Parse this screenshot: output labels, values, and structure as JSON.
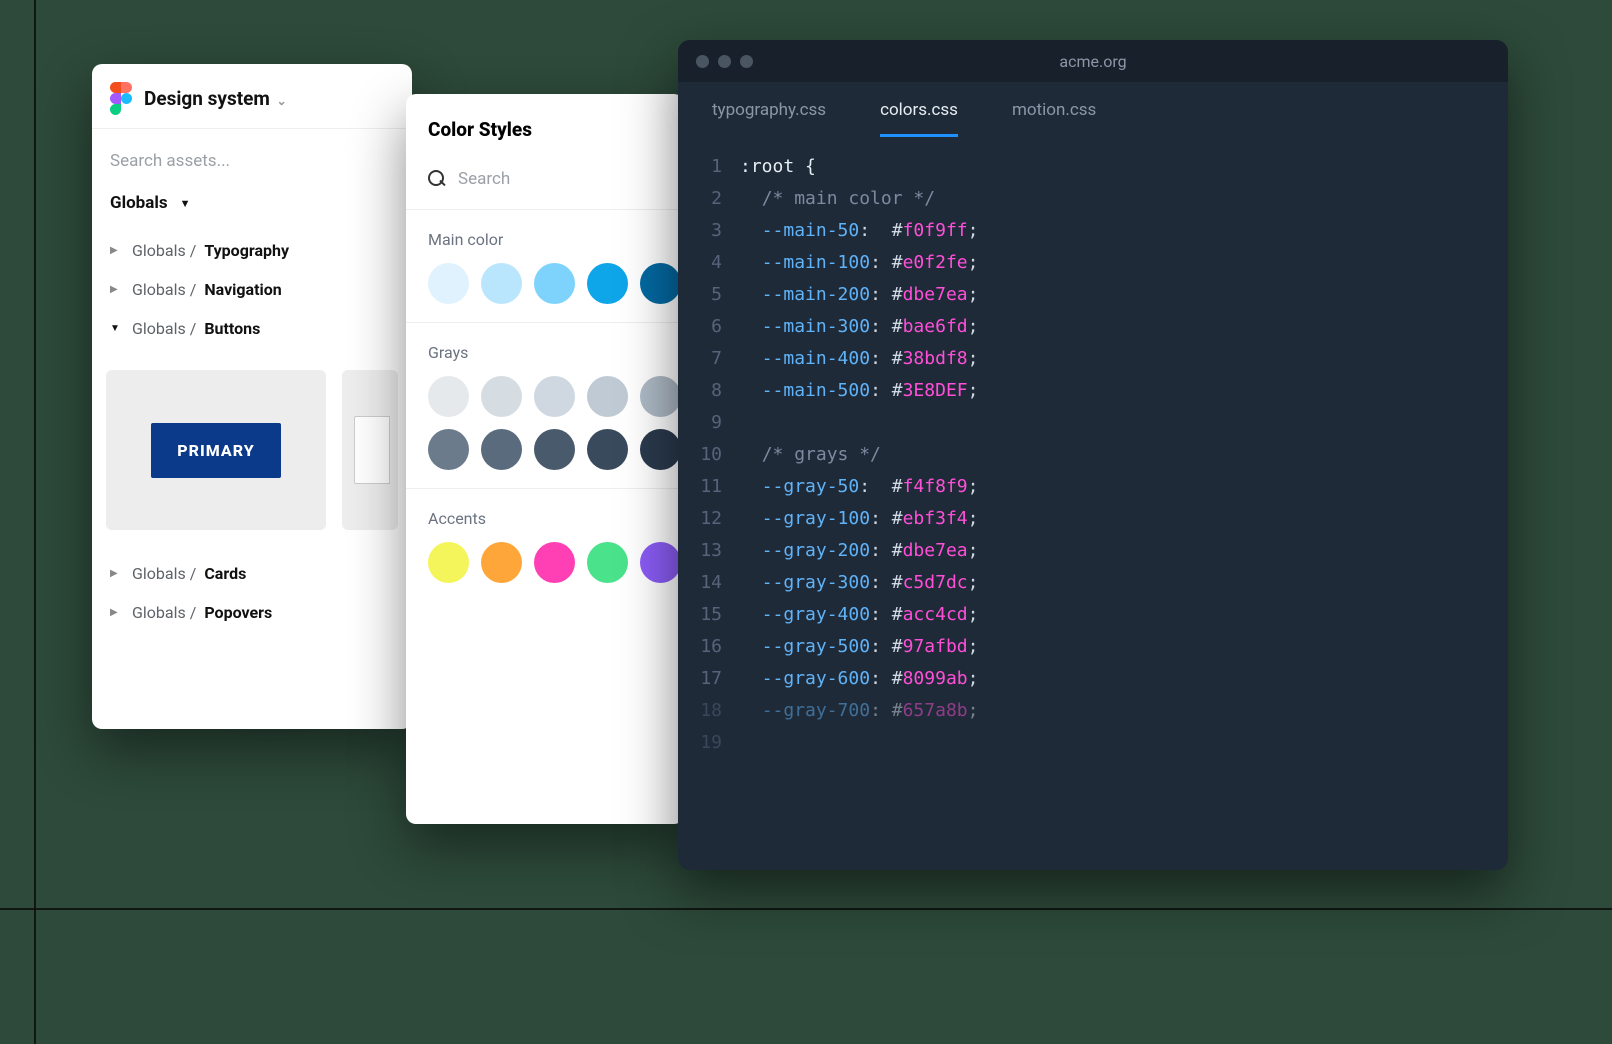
{
  "figma": {
    "title": "Design system",
    "search_placeholder": "Search assets...",
    "section": "Globals",
    "tree": [
      {
        "prefix": "Globals / ",
        "label": "Typography",
        "expanded": false
      },
      {
        "prefix": "Globals / ",
        "label": "Navigation",
        "expanded": false
      },
      {
        "prefix": "Globals / ",
        "label": "Buttons",
        "expanded": true
      },
      {
        "prefix": "Globals / ",
        "label": "Cards",
        "expanded": false
      },
      {
        "prefix": "Globals / ",
        "label": "Popovers",
        "expanded": false
      }
    ],
    "primary_button_label": "PRIMARY"
  },
  "styles": {
    "title": "Color Styles",
    "search_placeholder": "Search",
    "groups": {
      "main": {
        "label": "Main color",
        "swatches": [
          "#e0f2fe",
          "#bae6fd",
          "#7dd3fc",
          "#0ea5e9",
          "#0369a1"
        ]
      },
      "grays": {
        "label": "Grays",
        "row1": [
          "#e5e9ec",
          "#d6dde2",
          "#cfd8e0",
          "#bfcad4",
          "#aebac6"
        ],
        "row2": [
          "#6b7b8c",
          "#5a6b7d",
          "#4a5a6d",
          "#3a4a5d",
          "#2a3a4d"
        ]
      },
      "accents": {
        "label": "Accents",
        "swatches": [
          "#f4f55a",
          "#ffa63a",
          "#ff3fb4",
          "#4ae28a",
          "#8b5cf6"
        ]
      }
    }
  },
  "editor": {
    "url": "acme.org",
    "tabs": [
      "typography.css",
      "colors.css",
      "motion.css"
    ],
    "active_tab": "colors.css",
    "lines": [
      {
        "n": 1,
        "kind": "sel",
        "text": ":root {"
      },
      {
        "n": 2,
        "kind": "comment",
        "text": "/* main color */"
      },
      {
        "n": 3,
        "kind": "decl",
        "prop": "--main-50",
        "pad": "  ",
        "hex": "f0f9ff"
      },
      {
        "n": 4,
        "kind": "decl",
        "prop": "--main-100",
        "pad": " ",
        "hex": "e0f2fe"
      },
      {
        "n": 5,
        "kind": "decl",
        "prop": "--main-200",
        "pad": " ",
        "hex": "dbe7ea"
      },
      {
        "n": 6,
        "kind": "decl",
        "prop": "--main-300",
        "pad": " ",
        "hex": "bae6fd"
      },
      {
        "n": 7,
        "kind": "decl",
        "prop": "--main-400",
        "pad": " ",
        "hex": "38bdf8"
      },
      {
        "n": 8,
        "kind": "decl",
        "prop": "--main-500",
        "pad": " ",
        "hex": "3E8DEF"
      },
      {
        "n": 9,
        "kind": "blank",
        "text": ""
      },
      {
        "n": 10,
        "kind": "comment",
        "text": "/* grays */"
      },
      {
        "n": 11,
        "kind": "decl",
        "prop": "--gray-50",
        "pad": "  ",
        "hex": "f4f8f9"
      },
      {
        "n": 12,
        "kind": "decl",
        "prop": "--gray-100",
        "pad": " ",
        "hex": "ebf3f4"
      },
      {
        "n": 13,
        "kind": "decl",
        "prop": "--gray-200",
        "pad": " ",
        "hex": "dbe7ea"
      },
      {
        "n": 14,
        "kind": "decl",
        "prop": "--gray-300",
        "pad": " ",
        "hex": "c5d7dc"
      },
      {
        "n": 15,
        "kind": "decl",
        "prop": "--gray-400",
        "pad": " ",
        "hex": "acc4cd"
      },
      {
        "n": 16,
        "kind": "decl",
        "prop": "--gray-500",
        "pad": " ",
        "hex": "97afbd"
      },
      {
        "n": 17,
        "kind": "decl",
        "prop": "--gray-600",
        "pad": " ",
        "hex": "8099ab"
      },
      {
        "n": 18,
        "kind": "decl",
        "prop": "--gray-700",
        "pad": " ",
        "hex": "657a8b",
        "dim": true
      },
      {
        "n": 19,
        "kind": "blank",
        "text": "",
        "dim": true
      }
    ]
  }
}
